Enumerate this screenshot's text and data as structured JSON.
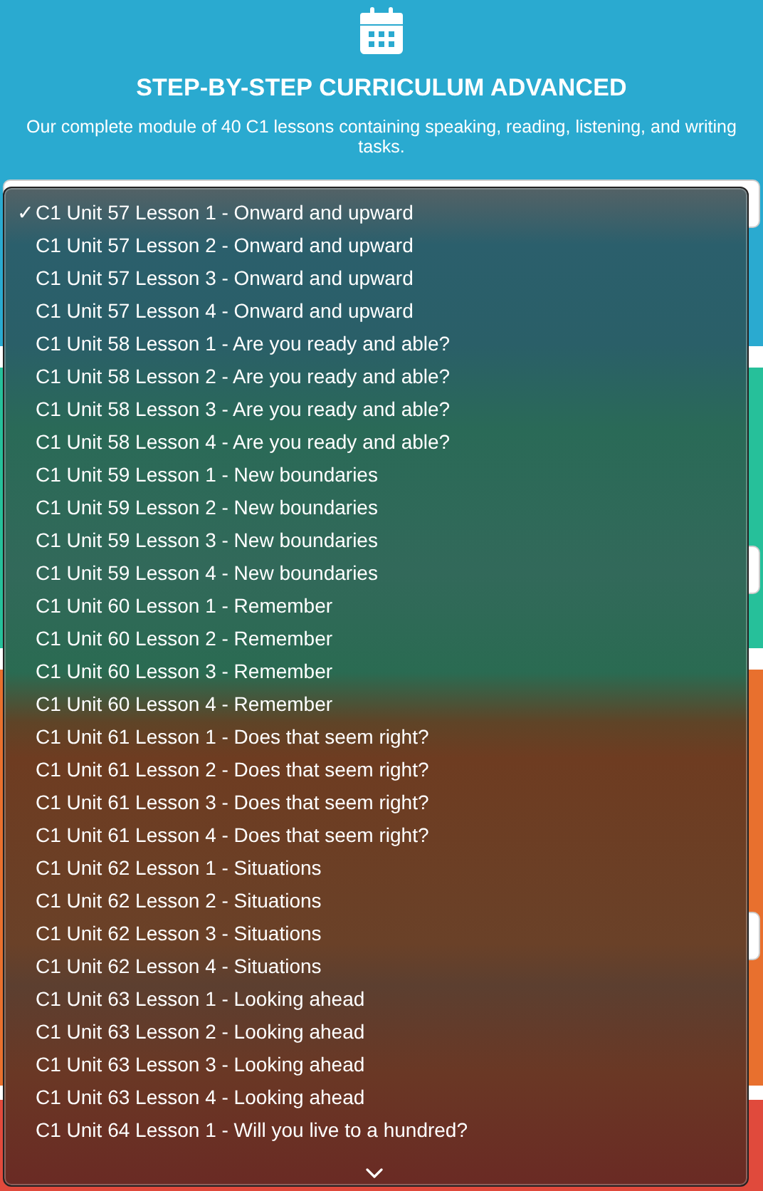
{
  "header": {
    "title": "STEP-BY-STEP CURRICULUM ADVANCED",
    "subtitle": "Our complete module of 40 C1 lessons containing speaking, reading, listening, and writing tasks."
  },
  "menu": {
    "check_mark": "✓",
    "items": [
      {
        "label": "C1 Unit 57 Lesson 1 - Onward and upward",
        "selected": true
      },
      {
        "label": "C1 Unit 57 Lesson 2 - Onward and upward",
        "selected": false
      },
      {
        "label": "C1 Unit 57 Lesson 3 - Onward and upward",
        "selected": false
      },
      {
        "label": "C1 Unit 57 Lesson 4 - Onward and upward",
        "selected": false
      },
      {
        "label": "C1 Unit 58 Lesson 1 - Are you ready and able?",
        "selected": false
      },
      {
        "label": "C1 Unit 58 Lesson 2 - Are you ready and able?",
        "selected": false
      },
      {
        "label": "C1 Unit 58 Lesson 3 - Are you ready and able?",
        "selected": false
      },
      {
        "label": "C1 Unit 58 Lesson 4 - Are you ready and able?",
        "selected": false
      },
      {
        "label": "C1 Unit 59 Lesson 1 - New boundaries",
        "selected": false
      },
      {
        "label": "C1 Unit 59 Lesson 2 - New boundaries",
        "selected": false
      },
      {
        "label": "C1 Unit 59 Lesson 3 - New boundaries",
        "selected": false
      },
      {
        "label": "C1 Unit 59 Lesson 4 - New boundaries",
        "selected": false
      },
      {
        "label": "C1 Unit 60 Lesson 1 - Remember",
        "selected": false
      },
      {
        "label": "C1 Unit 60 Lesson 2 - Remember",
        "selected": false
      },
      {
        "label": "C1 Unit 60 Lesson 3 - Remember",
        "selected": false
      },
      {
        "label": "C1 Unit 60 Lesson 4 - Remember",
        "selected": false
      },
      {
        "label": "C1 Unit 61 Lesson 1 - Does that seem right?",
        "selected": false
      },
      {
        "label": "C1 Unit 61 Lesson 2 - Does that seem right?",
        "selected": false
      },
      {
        "label": "C1 Unit 61 Lesson 3 - Does that seem right?",
        "selected": false
      },
      {
        "label": "C1 Unit 61 Lesson 4 - Does that seem right?",
        "selected": false
      },
      {
        "label": "C1 Unit 62 Lesson 1 - Situations",
        "selected": false
      },
      {
        "label": "C1 Unit 62 Lesson 2 - Situations",
        "selected": false
      },
      {
        "label": "C1 Unit 62 Lesson 3 - Situations",
        "selected": false
      },
      {
        "label": "C1 Unit 62 Lesson 4 - Situations",
        "selected": false
      },
      {
        "label": "C1 Unit 63 Lesson 1 - Looking ahead",
        "selected": false
      },
      {
        "label": "C1 Unit 63 Lesson 2 - Looking ahead",
        "selected": false
      },
      {
        "label": "C1 Unit 63 Lesson 3 - Looking ahead",
        "selected": false
      },
      {
        "label": "C1 Unit 63 Lesson 4 - Looking ahead",
        "selected": false
      },
      {
        "label": "C1 Unit 64 Lesson 1 - Will you live to a hundred?",
        "selected": false
      }
    ]
  }
}
